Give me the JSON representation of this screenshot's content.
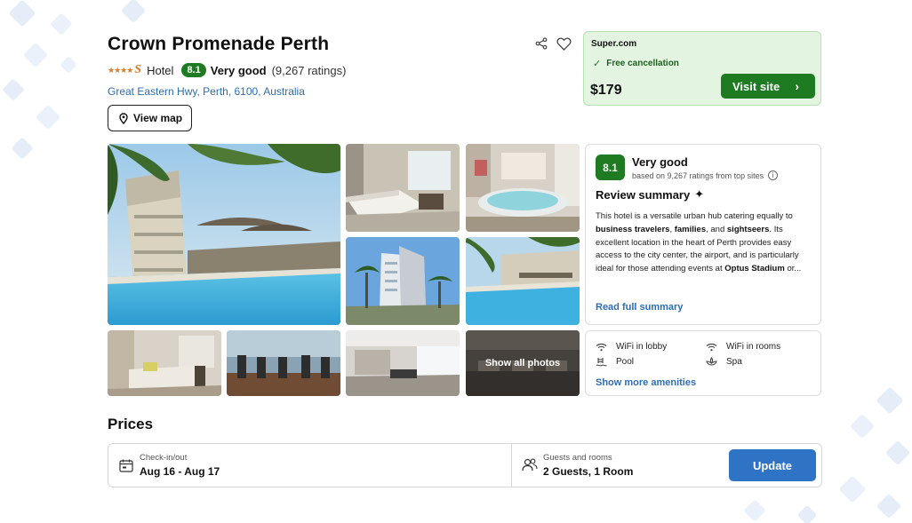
{
  "hotel": {
    "name": "Crown Promenade Perth",
    "stars": "★★★★",
    "star_suffix": "S",
    "type": "Hotel",
    "score": "8.1",
    "score_label": "Very good",
    "ratings_count": "(9,267 ratings)",
    "address": "Great Eastern Hwy, Perth, 6100, Australia",
    "view_map_label": "View map"
  },
  "header_icons": [
    "share-icon",
    "heart-icon"
  ],
  "deal": {
    "site": "Super.com",
    "cancellation": "Free cancellation",
    "price": "$179",
    "visit_label": "Visit site"
  },
  "gallery": {
    "show_all_label": "Show all photos",
    "photos": [
      "pool-exterior",
      "bedroom",
      "spa-bath-suite",
      "hotel-tower",
      "pool-deck",
      "lounge-room",
      "gym",
      "lobby",
      "dining-room"
    ]
  },
  "review": {
    "score": "8.1",
    "label": "Very good",
    "based_on": "based on 9,267 ratings from top sites",
    "summary_title": "Review summary",
    "body_1": "This hotel is a versatile urban hub catering equally to ",
    "bold_1": "business travelers",
    "body_2": ", ",
    "bold_2": "families",
    "body_3": ", and ",
    "bold_3": "sightseers",
    "body_4": ". Its excellent location in the heart of Perth provides easy access to the city center, the airport, and is particularly ideal for those attending events at ",
    "bold_4": "Optus Stadium",
    "body_5": " or...",
    "read_more": "Read full summary"
  },
  "amenities": {
    "items": [
      {
        "icon": "wifi-icon",
        "label": "WiFi in lobby"
      },
      {
        "icon": "wifi-icon",
        "label": "WiFi in rooms"
      },
      {
        "icon": "pool-icon",
        "label": "Pool"
      },
      {
        "icon": "spa-icon",
        "label": "Spa"
      }
    ],
    "more_label": "Show more amenities"
  },
  "prices": {
    "title": "Prices",
    "checkin_label": "Check-in/out",
    "checkin_value": "Aug 16 - Aug 17",
    "guests_label": "Guests and rooms",
    "guests_value": "2 Guests, 1 Room",
    "update_label": "Update"
  },
  "colors": {
    "brand_green": "#1e7b22",
    "link_blue": "#2d6db4",
    "update_blue": "#2f74c4",
    "deal_bg": "#e3f4e1"
  }
}
